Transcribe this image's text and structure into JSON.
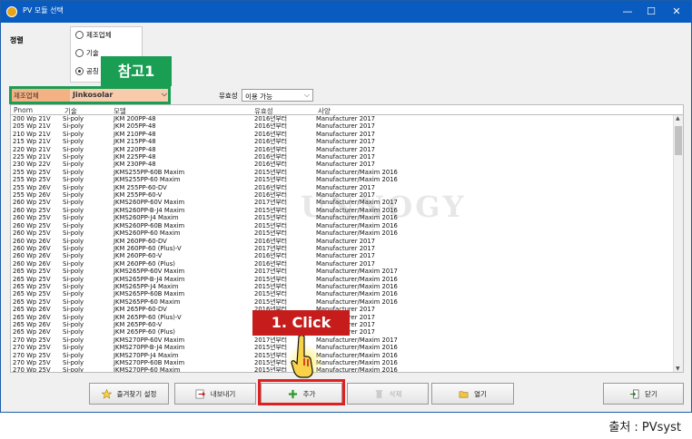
{
  "window": {
    "title": "PV 모듈 선택",
    "minimize": "—",
    "maximize": "☐",
    "close": "✕"
  },
  "sort": {
    "label": "정렬",
    "options": [
      "제조업체",
      "기술",
      "공칭"
    ],
    "selected_index": 2
  },
  "annotations": {
    "callout_ref": "참고1",
    "callout_click": "1. Click",
    "caption": "출처 : PVsyst",
    "watermark": "UNNOGY"
  },
  "filters": {
    "manufacturer_label": "제조업체",
    "manufacturer_value": "Jinkosolar",
    "validity_label": "유효성",
    "validity_value": "이용 가능"
  },
  "columns": [
    "Pnom",
    "기술",
    "모델",
    "유효성",
    "사양"
  ],
  "rows": [
    [
      "200 Wp 21V",
      "Si-poly",
      "JKM 200PP-48",
      "2016년부터",
      "Manufacturer 2017"
    ],
    [
      "205 Wp 21V",
      "Si-poly",
      "JKM 205PP-48",
      "2016년부터",
      "Manufacturer 2017"
    ],
    [
      "210 Wp 21V",
      "Si-poly",
      "JKM 210PP-48",
      "2016년부터",
      "Manufacturer 2017"
    ],
    [
      "215 Wp 21V",
      "Si-poly",
      "JKM 215PP-48",
      "2016년부터",
      "Manufacturer 2017"
    ],
    [
      "220 Wp 21V",
      "Si-poly",
      "JKM 220PP-48",
      "2016년부터",
      "Manufacturer 2017"
    ],
    [
      "225 Wp 21V",
      "Si-poly",
      "JKM 225PP-48",
      "2016년부터",
      "Manufacturer 2017"
    ],
    [
      "230 Wp 22V",
      "Si-poly",
      "JKM 230PP-48",
      "2016년부터",
      "Manufacturer 2017"
    ],
    [
      "255 Wp 25V",
      "Si-poly",
      "JKMS255PP-60B Maxim",
      "2015년부터",
      "Manufacturer/Maxim 2016"
    ],
    [
      "255 Wp 25V",
      "Si-poly",
      "JKMS255PP-60 Maxim",
      "2015년부터",
      "Manufacturer/Maxim 2016"
    ],
    [
      "255 Wp 26V",
      "Si-poly",
      "JKM 255PP-60-DV",
      "2016년부터",
      "Manufacturer 2017"
    ],
    [
      "255 Wp 26V",
      "Si-poly",
      "JKM 255PP-60-V",
      "2016년부터",
      "Manufacturer 2017"
    ],
    [
      "260 Wp 25V",
      "Si-poly",
      "JKMS260PP-60V Maxim",
      "2017년부터",
      "Manufacturer/Maxim 2017"
    ],
    [
      "260 Wp 25V",
      "Si-poly",
      "JKMS260PP-B-J4 Maxim",
      "2015년부터",
      "Manufacturer/Maxim 2016"
    ],
    [
      "260 Wp 25V",
      "Si-poly",
      "JKMS260PP-J4 Maxim",
      "2015년부터",
      "Manufacturer/Maxim 2016"
    ],
    [
      "260 Wp 25V",
      "Si-poly",
      "JKMS260PP-60B Maxim",
      "2015년부터",
      "Manufacturer/Maxim 2016"
    ],
    [
      "260 Wp 25V",
      "Si-poly",
      "JKMS260PP-60 Maxim",
      "2015년부터",
      "Manufacturer/Maxim 2016"
    ],
    [
      "260 Wp 26V",
      "Si-poly",
      "JKM 260PP-60-DV",
      "2016년부터",
      "Manufacturer 2017"
    ],
    [
      "260 Wp 26V",
      "Si-poly",
      "JKM 260PP-60 (Plus)-V",
      "2017년부터",
      "Manufacturer 2017"
    ],
    [
      "260 Wp 26V",
      "Si-poly",
      "JKM 260PP-60-V",
      "2016년부터",
      "Manufacturer 2017"
    ],
    [
      "260 Wp 26V",
      "Si-poly",
      "JKM 260PP-60 (Plus)",
      "2016년부터",
      "Manufacturer 2017"
    ],
    [
      "265 Wp 25V",
      "Si-poly",
      "JKMS265PP-60V Maxim",
      "2017년부터",
      "Manufacturer/Maxim 2017"
    ],
    [
      "265 Wp 25V",
      "Si-poly",
      "JKMS265PP-B-J4 Maxim",
      "2015년부터",
      "Manufacturer/Maxim 2016"
    ],
    [
      "265 Wp 25V",
      "Si-poly",
      "JKMS265PP-J4 Maxim",
      "2015년부터",
      "Manufacturer/Maxim 2016"
    ],
    [
      "265 Wp 25V",
      "Si-poly",
      "JKMS265PP-60B Maxim",
      "2015년부터",
      "Manufacturer/Maxim 2016"
    ],
    [
      "265 Wp 25V",
      "Si-poly",
      "JKMS265PP-60 Maxim",
      "2015년부터",
      "Manufacturer/Maxim 2016"
    ],
    [
      "265 Wp 26V",
      "Si-poly",
      "JKM 265PP-60-DV",
      "2016년부터",
      "Manufacturer 2017"
    ],
    [
      "265 Wp 26V",
      "Si-poly",
      "JKM 265PP-60 (Plus)-V",
      "2017년부터",
      "Manufacturer 2017"
    ],
    [
      "265 Wp 26V",
      "Si-poly",
      "JKM 265PP-60-V",
      "2016년부터",
      "Manufacturer 2017"
    ],
    [
      "265 Wp 26V",
      "Si-poly",
      "JKM 265PP-60 (Plus)",
      "2016년부터",
      "Manufacturer 2017"
    ],
    [
      "270 Wp 25V",
      "Si-poly",
      "JKMS270PP-60V Maxim",
      "2017년부터",
      "Manufacturer/Maxim 2017"
    ],
    [
      "270 Wp 25V",
      "Si-poly",
      "JKMS270PP-B-J4 Maxim",
      "2015년부터",
      "Manufacturer/Maxim 2016"
    ],
    [
      "270 Wp 25V",
      "Si-poly",
      "JKMS270PP-J4 Maxim",
      "2015년부터",
      "Manufacturer/Maxim 2016"
    ],
    [
      "270 Wp 25V",
      "Si-poly",
      "JKMS270PP-60B Maxim",
      "2015년부터",
      "Manufacturer/Maxim 2016"
    ],
    [
      "270 Wp 25V",
      "Si-poly",
      "JKMS270PP-60 Maxim",
      "2015년부터",
      "Manufacturer/Maxim 2016"
    ]
  ],
  "buttons": {
    "favorites": "즐겨찾기 설정",
    "export": "내보내기",
    "add": "추가",
    "delete": "삭제",
    "open": "열기",
    "close": "닫기"
  },
  "colors": {
    "titlebar": "#0a5bbf",
    "callout_green": "#1a9e54",
    "highlight_red": "#e02020",
    "mfr_orange": "#f8cbad"
  }
}
